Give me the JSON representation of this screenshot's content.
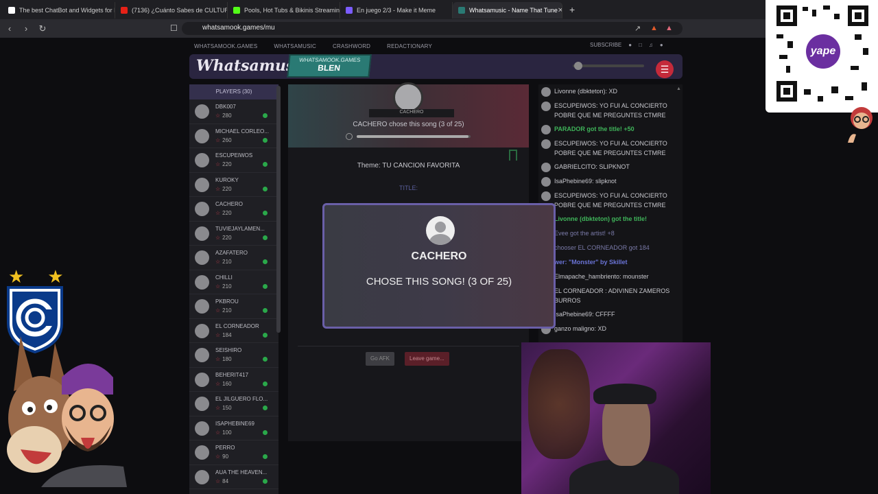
{
  "browser": {
    "tabs": [
      {
        "title": "The best ChatBot and Widgets for Ki",
        "color": "#ffffff"
      },
      {
        "title": "(7136) ¿Cuánto Sabes de CULTURA G",
        "color": "#e62117"
      },
      {
        "title": "Pools, Hot Tubs & Bikinis Streaming",
        "color": "#53fc18"
      },
      {
        "title": "En juego 2/3 - Make it Meme",
        "color": "#7b5cff"
      },
      {
        "title": "Whatsamusic - Name That Tune",
        "color": "#2a7a74"
      }
    ],
    "new_tab": "+",
    "url": "whatsamook.games/mu"
  },
  "site": {
    "nav": [
      "WHATSAMOOK.GAMES",
      "WHATSAMUSIC",
      "CRASHWORD",
      "REDACTIONARY"
    ],
    "subscribe": "SUBSCRIBE",
    "logo": "Whatsamusic",
    "room_top": "WHATSAMOOK.GAMES",
    "room_code": "BLEN"
  },
  "players": {
    "header": "PLAYERS (30)",
    "list": [
      {
        "name": "DBK007",
        "score": "280"
      },
      {
        "name": "MICHAEL CORLEO...",
        "score": "260"
      },
      {
        "name": "ESCUPEIWOS",
        "score": "220"
      },
      {
        "name": "KUROKY",
        "score": "220"
      },
      {
        "name": "CACHERO",
        "score": "220"
      },
      {
        "name": "TUVIEJAYLAMEN...",
        "score": "220"
      },
      {
        "name": "AZAFATERO",
        "score": "210"
      },
      {
        "name": "CHILLI",
        "score": "210"
      },
      {
        "name": "PKBROU",
        "score": "210"
      },
      {
        "name": "EL CORNEADOR",
        "score": "184"
      },
      {
        "name": "SEISHIRO",
        "score": "180"
      },
      {
        "name": "BEHERIT417",
        "score": "160"
      },
      {
        "name": "EL JILGUERO FLO...",
        "score": "150"
      },
      {
        "name": "ISAPHEBINE69",
        "score": "100"
      },
      {
        "name": "PERRO",
        "score": "90"
      },
      {
        "name": "AUA THE HEAVEN...",
        "score": "84"
      }
    ]
  },
  "game": {
    "chooser_ribbon": "CACHERO",
    "chose_text": "CACHERO chose this song (3 of 25)",
    "progress": 0.98,
    "theme": "Theme: TU CANCION FAVORITA",
    "title_label": "TITLE:",
    "afk": "Go AFK",
    "leave": "Leave game..."
  },
  "modal": {
    "name": "CACHERO",
    "text": "CHOSE THIS SONG! (3 OF 25)"
  },
  "chat": [
    {
      "text": "Livonne (dbkteton): XD",
      "type": "msg"
    },
    {
      "text": "ESCUPEIWOS: YO FUI AL CONCIERTO POBRE QUE ME PREGUNTES CTMRE",
      "type": "msg"
    },
    {
      "text": "PARADOR got the title! +50",
      "type": "sys"
    },
    {
      "text": "ESCUPEIWOS: YO FUI AL CONCIERTO POBRE QUE ME PREGUNTES CTMRE",
      "type": "msg"
    },
    {
      "text": "GABRIELCITO: SLIPKNOT",
      "type": "msg"
    },
    {
      "text": "IsaPhebine69: slipknot",
      "type": "msg"
    },
    {
      "text": "ESCUPEIWOS: YO FUI AL CONCIERTO POBRE QUE ME PREGUNTES CTMRE",
      "type": "msg"
    },
    {
      "text": "Livonne (dbkteton) got the title!",
      "type": "sys"
    },
    {
      "text": "Evee got the artist! +8",
      "type": "dim"
    },
    {
      "text": "chooser EL CORNEADOR got 184",
      "type": "dim"
    },
    {
      "text": "wer: \"Monster\" by Skillet",
      "type": "blue"
    },
    {
      "text": "Elmapache_hambriento: mounster",
      "type": "msg"
    },
    {
      "text": "EL CORNEADOR : ADIVINEN ZAMEROS BURROS",
      "type": "msg"
    },
    {
      "text": "IsaPhebine69: CFFFF",
      "type": "msg"
    },
    {
      "text": "ganzo maligno: XD",
      "type": "msg"
    }
  ],
  "overlay": {
    "yape": "yape"
  }
}
